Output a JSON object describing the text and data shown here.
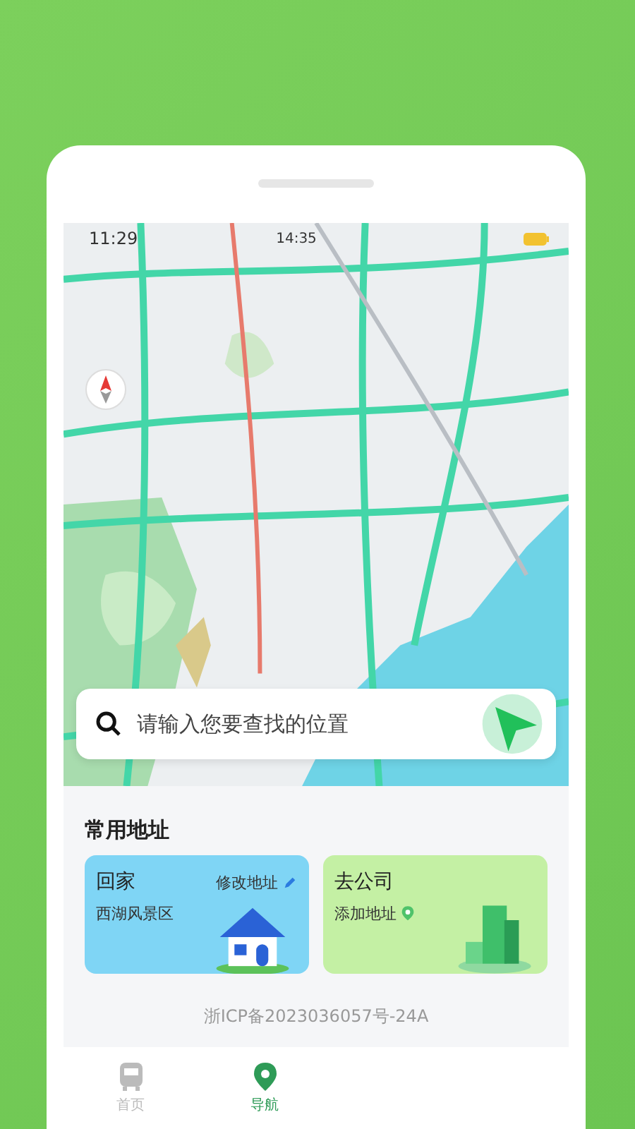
{
  "status_bar": {
    "time": "11:29",
    "clock": "14:35"
  },
  "search": {
    "placeholder": "请输入您要查找的位置"
  },
  "section_title": "常用地址",
  "addresses": [
    {
      "kind": "home",
      "title": "回家",
      "subtitle": "西湖风景区",
      "action": "修改地址"
    },
    {
      "kind": "work",
      "title": "去公司",
      "subtitle": "添加地址"
    }
  ],
  "icp": "浙ICP备2023036057号-24A",
  "tabs": [
    {
      "kind": "bus",
      "label": "首页",
      "selected": false
    },
    {
      "kind": "pin",
      "label": "导航",
      "selected": true
    }
  ]
}
